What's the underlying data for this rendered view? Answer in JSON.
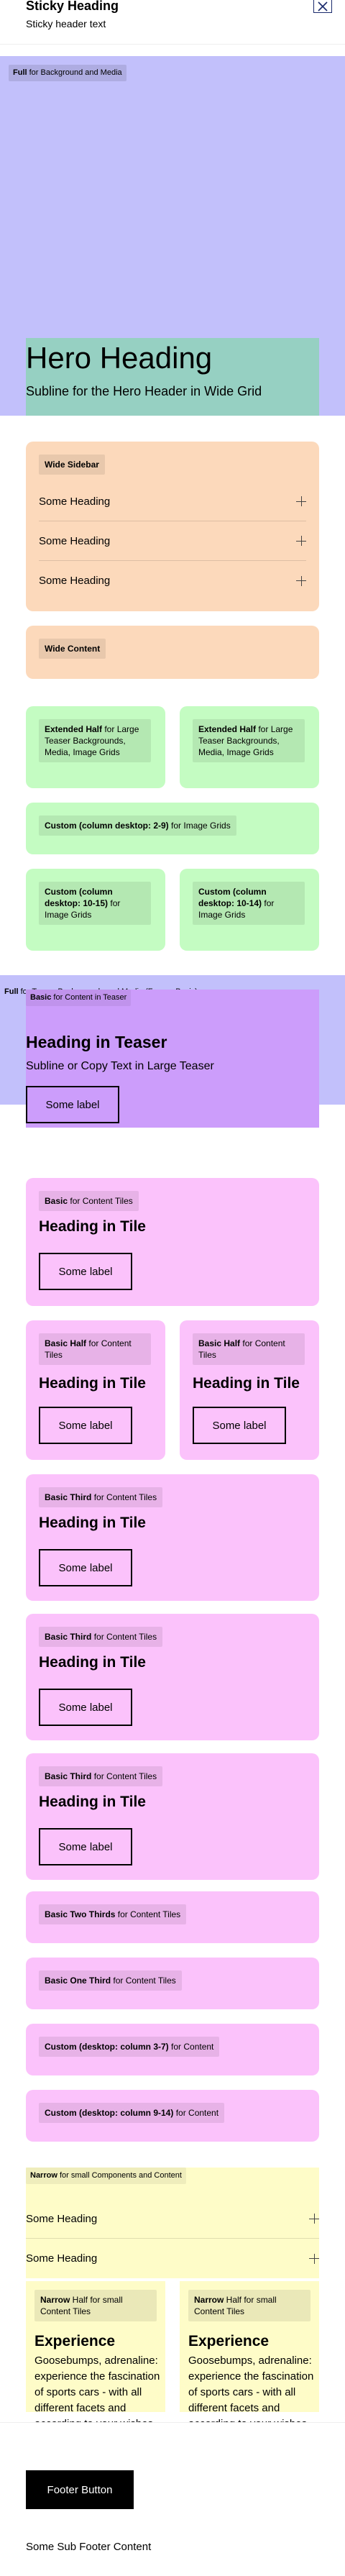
{
  "sticky_header": {
    "title": "Sticky Heading",
    "subtitle": "Sticky header text"
  },
  "full_hero": {
    "tag_bold": "Full",
    "tag_rest": " for Background and Media",
    "title": "Hero Heading",
    "subtitle": "Subline for the Hero Header in Wide Grid"
  },
  "wide_sidebar": {
    "tag": "Wide Sidebar",
    "items": [
      {
        "label": "Some Heading"
      },
      {
        "label": "Some Heading"
      },
      {
        "label": "Some Heading"
      }
    ]
  },
  "wide_content": {
    "tag": "Wide Content"
  },
  "extended_half": [
    {
      "bold": "Extended Half",
      "rest": " for Large Teaser Backgrounds, Media, Image Grids"
    },
    {
      "bold": "Extended Half",
      "rest": " for Large Teaser Backgrounds, Media, Image Grids"
    }
  ],
  "custom_2_9": {
    "bold": "Custom (column desktop: 2-9)",
    "rest": " for Image Grids"
  },
  "custom_image": [
    {
      "bold": "Custom (column desktop: 10-15)",
      "rest": " for Image Grids"
    },
    {
      "bold": "Custom (column desktop: 10-14)",
      "rest": " for Image Grids"
    }
  ],
  "full_teaser": {
    "tag_bold": "Full",
    "tag_rest": " for Teaser Backgrounds and Media (Former Basic)",
    "inner_bold": "Basic",
    "inner_rest": " for Content in Teaser",
    "title": "Heading in Teaser",
    "subtitle": "Subline or Copy Text in Large Teaser",
    "button": "Some label"
  },
  "basic_tiles": {
    "tag_bold": "Basic",
    "tag_rest": " for Content Tiles",
    "title": "Heading in Tile",
    "button": "Some label"
  },
  "basic_half": [
    {
      "bold": "Basic Half",
      "rest": " for Content Tiles",
      "title": "Heading in Tile",
      "button": "Some label"
    },
    {
      "bold": "Basic Half",
      "rest": " for Content Tiles",
      "title": "Heading in Tile",
      "button": "Some label"
    }
  ],
  "basic_third": [
    {
      "bold": "Basic Third",
      "rest": " for Content Tiles",
      "title": "Heading in Tile",
      "button": "Some label"
    },
    {
      "bold": "Basic Third",
      "rest": " for Content Tiles",
      "title": "Heading in Tile",
      "button": "Some label"
    },
    {
      "bold": "Basic Third",
      "rest": " for Content Tiles",
      "title": "Heading in Tile",
      "button": "Some label"
    }
  ],
  "basic_two_thirds": {
    "bold": "Basic Two Thirds",
    "rest": " for Content Tiles"
  },
  "basic_one_third": {
    "bold": "Basic One Third",
    "rest": " for Content Tiles"
  },
  "custom_3_7": {
    "bold": "Custom (desktop: column 3-7)",
    "rest": " for Content"
  },
  "custom_9_14": {
    "bold": "Custom (desktop: column 9-14)",
    "rest": " for Content"
  },
  "narrow": {
    "tag_bold": "Narrow",
    "tag_rest": " for small Components and Content",
    "items": [
      {
        "label": "Some Heading"
      },
      {
        "label": "Some Heading"
      }
    ]
  },
  "narrow_half": [
    {
      "bold": "Narrow",
      "rest": " Half for small Content Tiles",
      "title": "Experience",
      "text": "Goosebumps, adrenaline: experience the fascination of sports cars - with all different facets and according to your wishes."
    },
    {
      "bold": "Narrow",
      "rest": " Half for small Content Tiles",
      "title": "Experience",
      "text": "Goosebumps, adrenaline: experience the fascination of sports cars - with all different facets and according to your wishes."
    }
  ],
  "footer": {
    "button": "Footer Button",
    "sub": "Some Sub Footer Content"
  },
  "colors": {
    "lavender": "#c2c0fb",
    "teal": "#96d0c2",
    "orange": "#fcd9bb",
    "green": "#c4fcc2",
    "pink": "#fbc2fb",
    "purple": "#cc9dfb",
    "yellow": "#fefcc8"
  }
}
